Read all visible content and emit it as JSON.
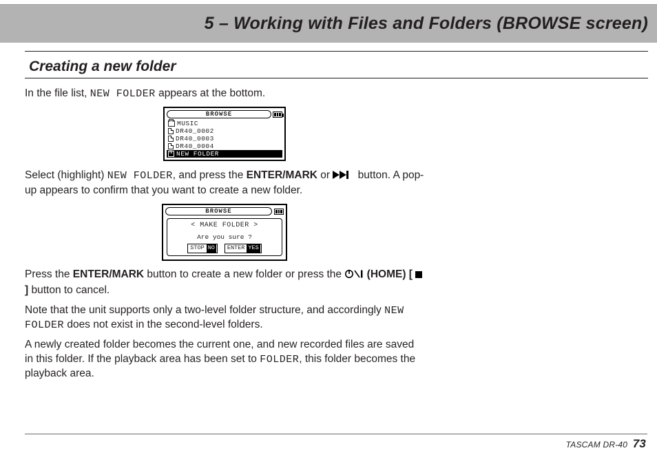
{
  "header": {
    "chapter_title": "5 – Working with Files and Folders (BROWSE screen)"
  },
  "section": {
    "heading": "Creating a new folder"
  },
  "body": {
    "p1a": "In the file list, ",
    "p1_code": "NEW FOLDER",
    "p1b": " appears at the bottom.",
    "p2a": "Select (highlight) ",
    "p2_code": "NEW FOLDER",
    "p2b": ", and press the ",
    "p2_bold1": "ENTER/MARK",
    "p2c": " or ",
    "p2d": " button. A pop-up appears to confirm that you want to create a new folder.",
    "p3a": "Press the ",
    "p3_bold1": "ENTER/MARK",
    "p3b": " button to create a new folder or press the ",
    "p3_bold2": "(HOME) [",
    "p3_bold3": "]",
    "p3c": " button to cancel.",
    "p4a": "Note that the unit supports only a two-level folder structure, and accordingly ",
    "p4_code": "NEW FOLDER",
    "p4b": " does not exist in the second-level folders.",
    "p5a": "A newly created folder becomes the current one, and new recorded files are saved in this folder. If the playback area has been set to ",
    "p5_code": "FOLDER",
    "p5b": ", this folder becomes the playback area."
  },
  "lcd1": {
    "title": "BROWSE",
    "rows": [
      "MUSIC",
      "DR40_0002",
      "DR40_0003",
      "DR40_0004",
      "NEW FOLDER"
    ]
  },
  "lcd2": {
    "title": "BROWSE",
    "line1": "< MAKE FOLDER >",
    "line2": "Are you sure ?",
    "btn1_label": "STOP",
    "btn1_value": "NO",
    "btn2_label": "ENTER",
    "btn2_value": "YES"
  },
  "footer": {
    "model": "TASCAM DR-40",
    "page": "73"
  }
}
